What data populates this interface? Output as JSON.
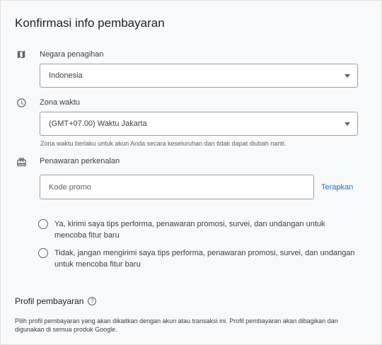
{
  "title": "Konfirmasi info pembayaran",
  "billing_country": {
    "label": "Negara penagihan",
    "value": "Indonesia",
    "icon": "map-icon"
  },
  "timezone": {
    "label": "Zona waktu",
    "value": "(GMT+07.00) Waktu Jakarta",
    "helper": "Zona waktu berlaku untuk akun Anda secara keseluruhan dan tidak dapat diubah nanti.",
    "icon": "clock-icon"
  },
  "promo": {
    "label": "Penawaran perkenalan",
    "placeholder": "Kode promo",
    "apply_label": "Terapkan",
    "icon": "gift-icon"
  },
  "email_prefs": {
    "options": [
      {
        "label": "Ya, kirimi saya tips performa, penawaran promosi, survei, dan undangan untuk mencoba fitur baru",
        "selected": false
      },
      {
        "label": "Tidak, jangan mengirimi saya tips performa, penawaran promosi, survei, dan undangan untuk mencoba fitur baru",
        "selected": false
      }
    ]
  },
  "profile": {
    "title": "Profil pembayaran",
    "help_icon": "help-icon",
    "description": "Pilih profil pembayaran yang akan dikaitkan dengan akun atau transaksi ini. Profil pembayaran akan dibagikan dan digunakan di semua produk Google."
  },
  "colors": {
    "accent": "#1a73e8",
    "text": "#202124",
    "muted": "#5f6368",
    "background": "#f8f9fa"
  }
}
